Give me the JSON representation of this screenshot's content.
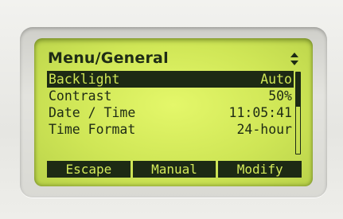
{
  "screen": {
    "title": "Menu/General",
    "nav_icon": "up-down-arrows-icon"
  },
  "menu": {
    "items": [
      {
        "label": "Backlight",
        "value": "Auto",
        "selected": true
      },
      {
        "label": "Contrast",
        "value": "50%",
        "selected": false
      },
      {
        "label": "Date / Time",
        "value": "11:05:41",
        "selected": false
      },
      {
        "label": "Time Format",
        "value": "24-hour",
        "selected": false
      }
    ]
  },
  "softkeys": {
    "left": "Escape",
    "middle": "Manual",
    "right": "Modify"
  },
  "colors": {
    "lcd_background": "#d6ea5c",
    "lcd_foreground": "#1d2a14",
    "bezel": "#d9d9d4"
  }
}
